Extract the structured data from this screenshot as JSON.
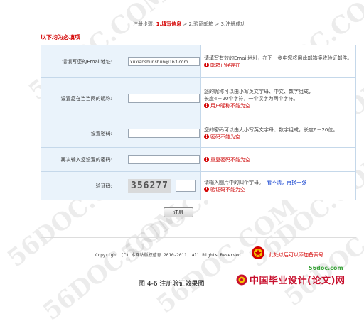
{
  "watermarks": [
    "56DOC.COM",
    "56DOC.COM",
    "56DOC.COM",
    "56DOC.COM",
    "56DOC.COM",
    "56DOC.COM",
    "56DOC.COM",
    "56DOC.COM",
    "56DOC.COM",
    "56DOC.COM"
  ],
  "steps": {
    "prefix": "注册步骤:",
    "step1": "1.填写信息",
    "sep": ">",
    "step2": "2.验证邮箱",
    "step3": "3.注册成功"
  },
  "required_note": "以下均为必填项",
  "fields": {
    "email": {
      "label": "请填写您的Email地址:",
      "value": "xuxianshunshun@163.com",
      "hint": "请填写有效的Email地址，在下一步中您将用此邮箱接收验证邮件。",
      "error": "邮箱已经存在"
    },
    "nickname": {
      "label": "设置您在当当网的昵称:",
      "value": "",
      "hint1": "您的昵称可以由小写英文字母、中文、数字组成，",
      "hint2": "长度4－20个字符，一个汉字为两个字符。",
      "error": "用户昵称不能为空"
    },
    "password": {
      "label": "设置密码:",
      "value": "",
      "hint": "您的密码可以由大小写英文字母、数字组成，长度6－20位。",
      "error": "密码不能为空"
    },
    "confirm": {
      "label": "再次输入您设置的密码:",
      "value": "",
      "error": "重复密码不能为空"
    },
    "captcha": {
      "label": "验证码:",
      "image_text": "356277",
      "value": "",
      "hint": "请输入图片中的四个字母。",
      "refresh": "看不清，再换一张",
      "error": "验证码不能为空"
    }
  },
  "submit_label": "注册",
  "footer": {
    "copyright": "Copyright (C) 本网站版权信息 2010-2011, All Rights Reserved",
    "icp": "此处以后可以添加备案号"
  },
  "caption": "图 4-6  注册验证效果图",
  "brand": {
    "url": "56doc.com",
    "name": "中国毕业设计(论文)网"
  },
  "colors": {
    "accent_red": "#d40000",
    "cell_bg": "#eaf3fb",
    "border": "#c5d8ea"
  },
  "icons": {
    "error": "red-circle-error-icon",
    "seal": "red-emblem-icon",
    "brand": "red-emblem-logo-icon"
  }
}
